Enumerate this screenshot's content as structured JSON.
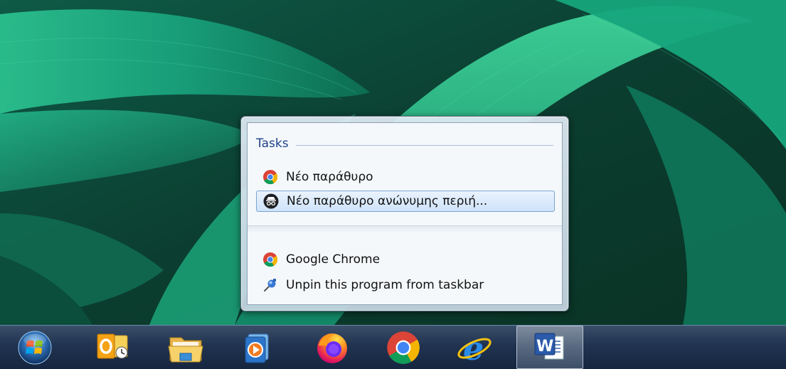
{
  "jumplist": {
    "tasks_header": "Tasks",
    "tasks": [
      {
        "label": "Νέο παράθυρο",
        "icon": "chrome-icon"
      },
      {
        "label": "Νέο παράθυρο ανώνυμης περιή...",
        "icon": "incognito-icon"
      }
    ],
    "program": {
      "label": "Google Chrome",
      "icon": "chrome-icon"
    },
    "unpin": {
      "label": "Unpin this program from taskbar",
      "icon": "unpin-icon"
    }
  },
  "taskbar": {
    "start": "start-orb",
    "apps": [
      {
        "name": "outlook",
        "icon": "outlook-icon"
      },
      {
        "name": "file-explorer",
        "icon": "folder-icon"
      },
      {
        "name": "media-player",
        "icon": "media-player-icon"
      },
      {
        "name": "firefox",
        "icon": "firefox-icon"
      },
      {
        "name": "chrome",
        "icon": "chrome-icon"
      },
      {
        "name": "internet-explorer",
        "icon": "ie-icon"
      },
      {
        "name": "word",
        "icon": "word-icon",
        "active": true
      }
    ]
  },
  "colors": {
    "accent_header": "#1e3f8a",
    "taskbar": "#203350",
    "wallpaper_primary": "#1fa37a"
  }
}
